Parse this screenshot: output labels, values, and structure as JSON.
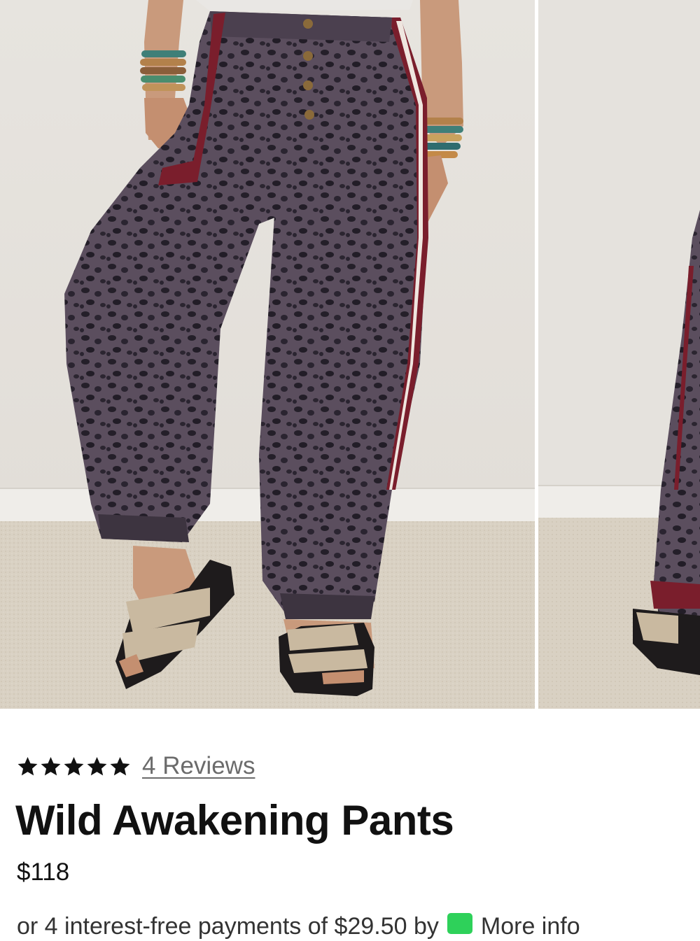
{
  "gallery": {
    "main_image_alt": "Wild Awakening Pants",
    "next_image_alt": "Wild Awakening Pants"
  },
  "product": {
    "rating_stars": 5,
    "reviews_link": "4 Reviews",
    "title": "Wild Awakening Pants",
    "price": "$118"
  },
  "installments": {
    "text_partial": "or 4 interest-free payments of $29.50 by",
    "more_info": "More info"
  },
  "colors": {
    "star": "#111111",
    "reviews_link": "#6b6b6b",
    "badge": "#2ed15a"
  }
}
